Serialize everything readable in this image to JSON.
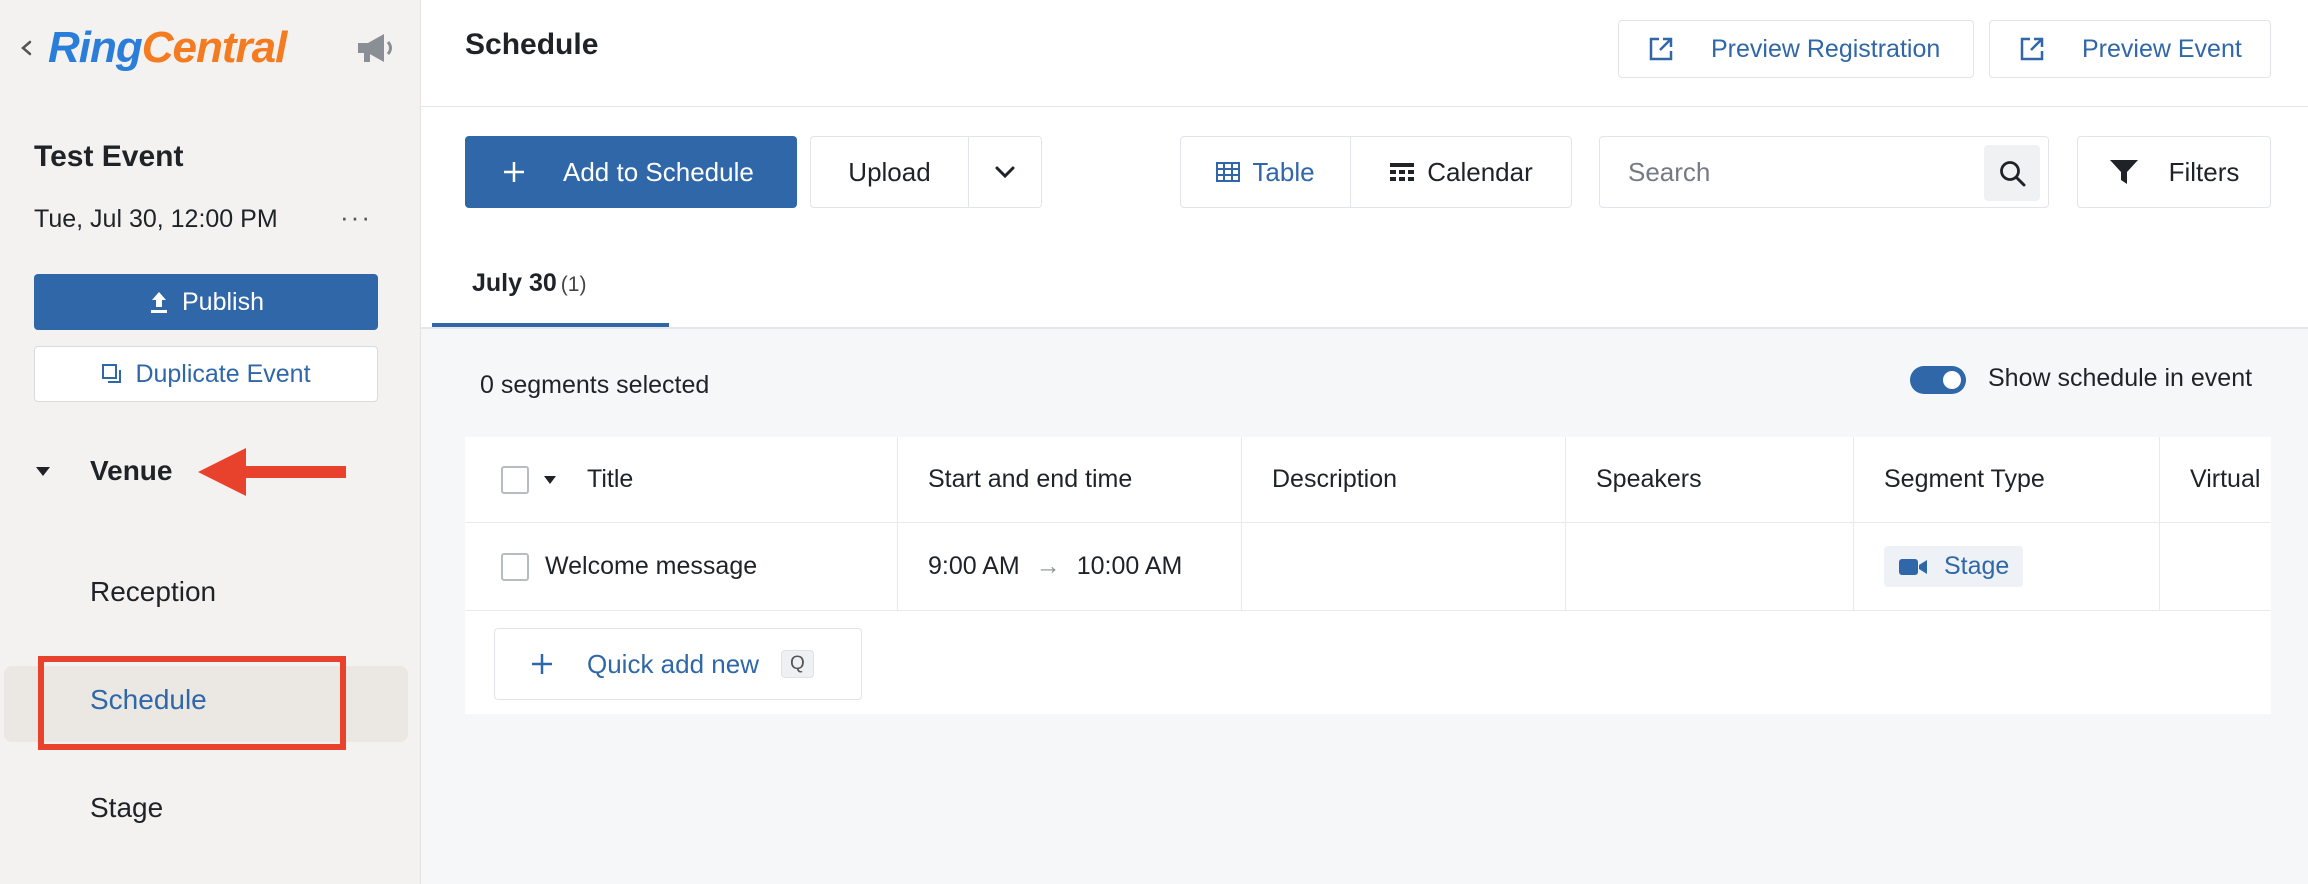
{
  "app": {
    "logo_ring": "Ring",
    "logo_central": "Central"
  },
  "sidebar": {
    "event_title": "Test Event",
    "event_date": "Tue, Jul 30, 12:00 PM",
    "more_label": "···",
    "publish_label": "Publish",
    "duplicate_label": "Duplicate Event",
    "section_label": "Venue",
    "items": [
      {
        "label": "Reception",
        "active": false
      },
      {
        "label": "Schedule",
        "active": true
      },
      {
        "label": "Stage",
        "active": false
      }
    ]
  },
  "header": {
    "title": "Schedule",
    "preview_registration": "Preview Registration",
    "preview_event": "Preview Event"
  },
  "toolbar": {
    "add_label": "Add to Schedule",
    "upload_label": "Upload",
    "view_table": "Table",
    "view_calendar": "Calendar",
    "search_placeholder": "Search",
    "filters_label": "Filters"
  },
  "date_tab": {
    "label": "July 30",
    "count": "(1)"
  },
  "selection": {
    "text": "0 segments selected",
    "show_schedule_label": "Show schedule in event",
    "show_schedule_on": true
  },
  "table": {
    "columns": [
      "Title",
      "Start and end time",
      "Description",
      "Speakers",
      "Segment Type",
      "Virtual"
    ],
    "rows": [
      {
        "title": "Welcome message",
        "start": "9:00 AM",
        "arrow": "→",
        "end": "10:00 AM",
        "description": "",
        "speakers": "",
        "segment_type": "Stage",
        "virtual": ""
      }
    ],
    "quick_add_label": "Quick add new",
    "quick_add_key": "Q"
  },
  "colors": {
    "primary": "#2f67a8",
    "annotation": "#e8412c",
    "logo_blue": "#2a7dd9",
    "logo_orange": "#f47b20"
  }
}
